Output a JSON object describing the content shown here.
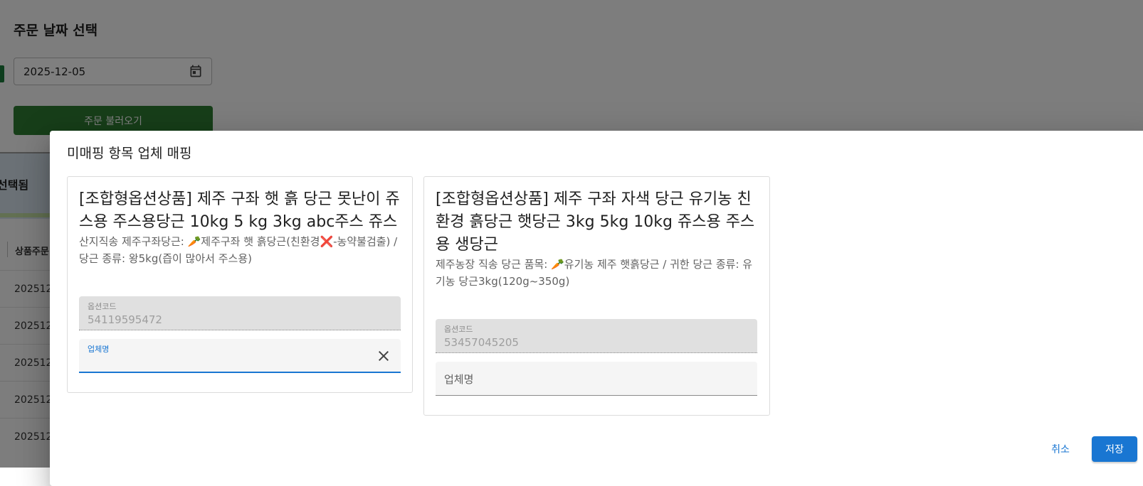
{
  "background": {
    "title": "주문 날짜 선택",
    "date_value": "2025-12-05",
    "load_button": "주문 불러오기",
    "selected_label": "선택됨",
    "column_header": "상품주문",
    "rows": [
      "202512",
      "202512",
      "202512",
      "202512",
      "202512"
    ]
  },
  "dialog": {
    "title": "미매핑 항목 업체 매핑",
    "cards": [
      {
        "product_title": "[조합형옵션상품] 제주 구좌 햇 흙 당근 못난이 쥬스용 주스용당근 10kg 5 kg 3kg abc주스 쥬스",
        "option_description": "산지직송 제주구좌당근: 🥕제주구좌 햇 흙당근(친환경❌-농약불검출) / 당근 종류: 왕5kg(즙이 많아서 주스용)",
        "option_code_label": "옵션코드",
        "option_code_value": "54119595472",
        "vendor_label": "업체명",
        "vendor_value": ""
      },
      {
        "product_title": "[조합형옵션상품] 제주 구좌 자색 당근 유기농 친환경 흙당근 햇당근 3kg 5kg 10kg 쥬스용 주스용 생당근",
        "option_description": "제주농장 직송 당근 품목: 🥕유기농 제주 햇흙당근 / 귀한 당근 종류: 유기농 당근3kg(120g~350g)",
        "option_code_label": "옵션코드",
        "option_code_value": "53457045205",
        "vendor_label": "업체명",
        "vendor_value": ""
      }
    ],
    "cancel_label": "취소",
    "save_label": "저장"
  },
  "colors": {
    "primary": "#1976d2",
    "load_button": "#2e7d32",
    "backdrop": "rgba(0,0,0,0.5)"
  }
}
